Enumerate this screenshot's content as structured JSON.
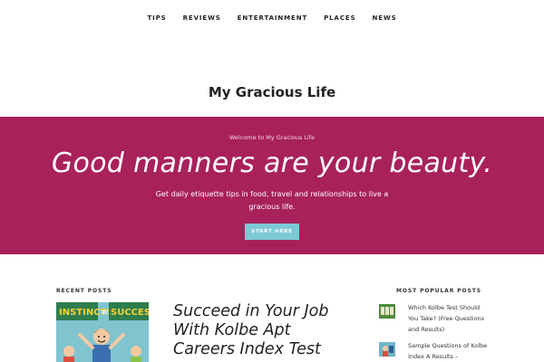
{
  "nav": {
    "items": [
      {
        "label": "TIPS"
      },
      {
        "label": "REVIEWS"
      },
      {
        "label": "ENTERTAINMENT"
      },
      {
        "label": "PLACES"
      },
      {
        "label": "NEWS"
      }
    ]
  },
  "site": {
    "title": "My Gracious Life"
  },
  "hero": {
    "welcome": "Welcome to My Gracious Life",
    "headline": "Good manners are your beauty.",
    "subtitle": "Get daily etiquette tips in food, travel and relationships to live a gracious life.",
    "button_label": "START HERE",
    "background_color": "#a8215b",
    "button_color": "#7ec9d7"
  },
  "recent_posts": {
    "heading": "RECENT POSTS",
    "items": [
      {
        "title": "Succeed in Your Job With Kolbe Apt Careers Index Test",
        "thumbnail_text_left": "INSTINCTS",
        "thumbnail_text_mid": "=",
        "thumbnail_text_right": "SUCCESS"
      }
    ]
  },
  "popular_posts": {
    "heading": "MOST POPULAR POSTS",
    "items": [
      {
        "title": "Which Kolbe Test Should You Take? (Free Questions and Results)"
      },
      {
        "title": "Sample Questions of Kolbe Index A Results – Personality"
      }
    ]
  }
}
